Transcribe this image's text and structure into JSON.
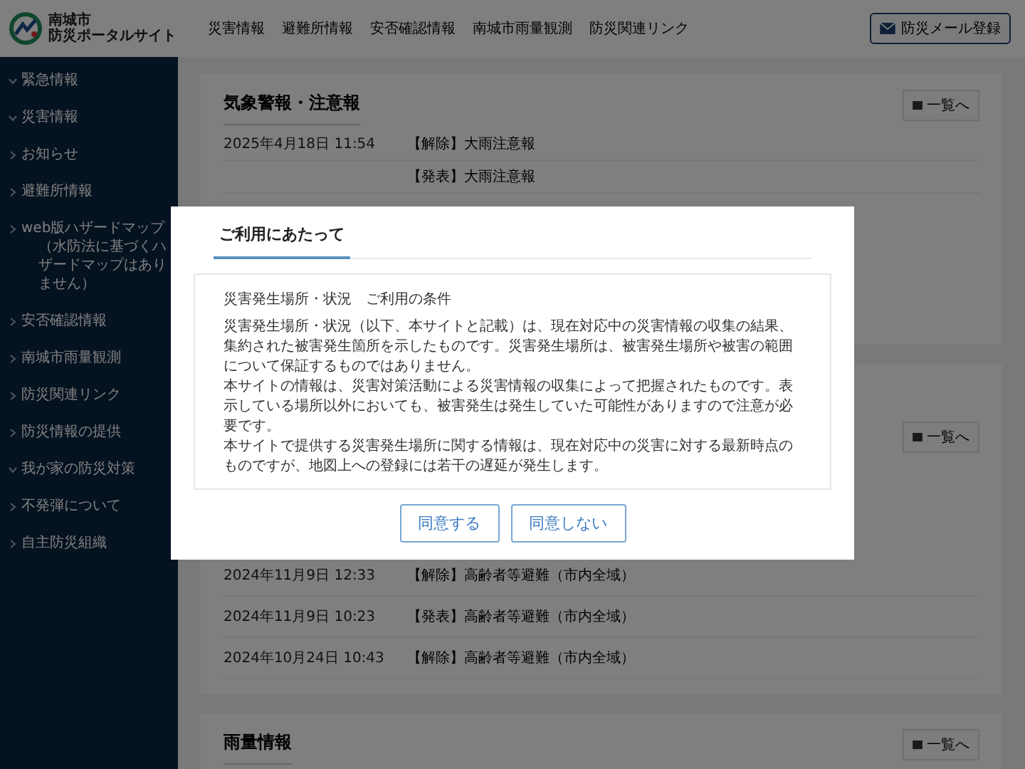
{
  "header": {
    "logo_line1": "南城市",
    "logo_line2": "防災ポータルサイト",
    "nav": [
      "災害情報",
      "避難所情報",
      "安否確認情報",
      "南城市雨量観測",
      "防災関連リンク"
    ],
    "mail_button": "防災メール登録"
  },
  "sidebar": {
    "items": [
      {
        "label": "緊急情報",
        "expanded": true
      },
      {
        "label": "災害情報",
        "expanded": true
      },
      {
        "label": "お知らせ",
        "expanded": false
      },
      {
        "label": "避難所情報",
        "expanded": false
      },
      {
        "label": "web版ハザードマップ",
        "note": "（水防法に基づくハザードマップはありません）",
        "expanded": false
      },
      {
        "label": "安否確認情報",
        "expanded": false
      },
      {
        "label": "南城市雨量観測",
        "expanded": false
      },
      {
        "label": "防災関連リンク",
        "expanded": false
      },
      {
        "label": "防災情報の提供",
        "expanded": false
      },
      {
        "label": "我が家の防災対策",
        "expanded": true
      },
      {
        "label": "不発弾について",
        "expanded": false
      },
      {
        "label": "自主防災組織",
        "expanded": false
      }
    ]
  },
  "sections": [
    {
      "title": "気象警報・注意報",
      "list_button": "一覧へ",
      "rows": [
        {
          "date": "2025年4月18日 11:54",
          "text": "【解除】大雨注意報"
        },
        {
          "text": "【発表】大雨注意報"
        }
      ]
    },
    {
      "list_button": "一覧へ",
      "rows": [
        {
          "date": "2024年11月9日 12:33",
          "text": "【解除】高齢者等避難（市内全域）"
        },
        {
          "date": "2024年11月9日 10:23",
          "text": "【発表】高齢者等避難（市内全域）"
        },
        {
          "date": "2024年10月24日 10:43",
          "text": "【解除】高齢者等避難（市内全域）"
        }
      ]
    },
    {
      "title": "雨量情報",
      "list_button": "一覧へ"
    }
  ],
  "modal": {
    "title": "ご利用にあたって",
    "heading": "災害発生場所・状況　ご利用の条件",
    "paragraphs": [
      "災害発生場所・状況（以下、本サイトと記載）は、現在対応中の災害情報の収集の結果、集約された被害発生箇所を示したものです。災害発生場所は、被害発生場所や被害の範囲について保証するものではありません。",
      "本サイトの情報は、災害対策活動による災害情報の収集によって把握されたものです。表示している場所以外においても、被害発生は発生していた可能性がありますので注意が必要です。",
      "本サイトで提供する災害発生場所に関する情報は、現在対応中の災害に対する最新時点のものですが、地図上への登録には若干の遅延が発生します。"
    ],
    "buttons": [
      "同意する",
      "同意しない"
    ]
  }
}
